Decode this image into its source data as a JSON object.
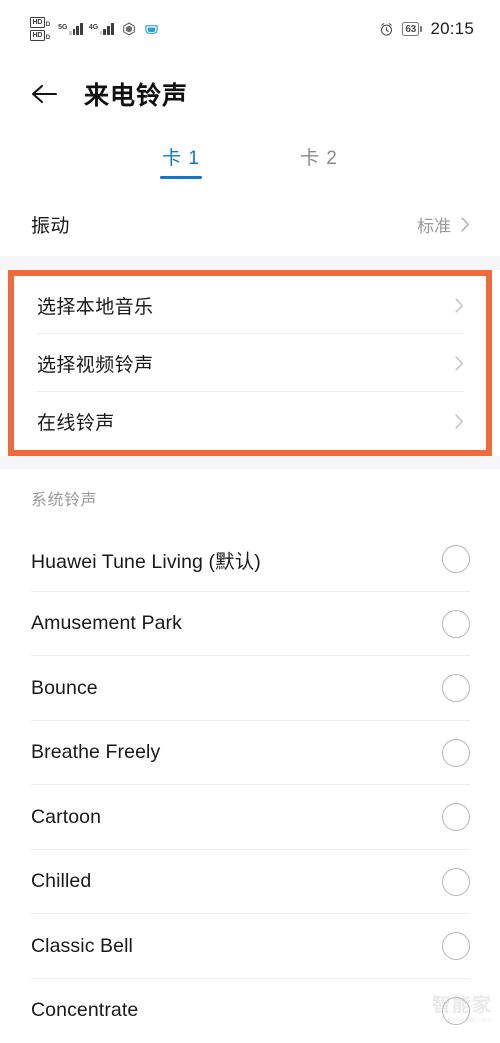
{
  "status_bar": {
    "hd_badges": [
      {
        "label": "HD",
        "sub": "D"
      },
      {
        "label": "HD",
        "sub": "D"
      }
    ],
    "signals": [
      {
        "network": "5G"
      },
      {
        "network": "4G"
      }
    ],
    "icons": [
      "hexagon-shield-icon",
      "wifi-hotspot-icon",
      "alarm-clock-icon"
    ],
    "battery_level": "63",
    "time": "20:15"
  },
  "app_bar": {
    "back_icon": "back-arrow-icon",
    "title": "来电铃声"
  },
  "tabs": [
    {
      "label": "卡 1",
      "active": true
    },
    {
      "label": "卡 2",
      "active": false
    }
  ],
  "vibration_row": {
    "label": "振动",
    "value": "标准",
    "chevron": "chevron-right-icon"
  },
  "highlighted_group": {
    "highlight_color": "#ef6b3e",
    "items": [
      {
        "label": "选择本地音乐",
        "chevron": "chevron-right-icon"
      },
      {
        "label": "选择视频铃声",
        "chevron": "chevron-right-icon"
      },
      {
        "label": "在线铃声",
        "chevron": "chevron-right-icon"
      }
    ]
  },
  "system_ringtones": {
    "section_title": "系统铃声",
    "items": [
      {
        "label": "Huawei Tune Living (默认)",
        "selected": false
      },
      {
        "label": "Amusement Park",
        "selected": false
      },
      {
        "label": "Bounce",
        "selected": false
      },
      {
        "label": "Breathe Freely",
        "selected": false
      },
      {
        "label": "Cartoon",
        "selected": false
      },
      {
        "label": "Chilled",
        "selected": false
      },
      {
        "label": "Classic Bell",
        "selected": false
      },
      {
        "label": "Concentrate",
        "selected": false
      }
    ]
  },
  "watermark": {
    "main": "智能家",
    "sub": "www.zhi.com"
  },
  "colors": {
    "accent_blue": "#1277c9",
    "highlight_orange": "#ef6b3e",
    "divider": "#ededed",
    "section_gap": "#f6f5f7"
  }
}
